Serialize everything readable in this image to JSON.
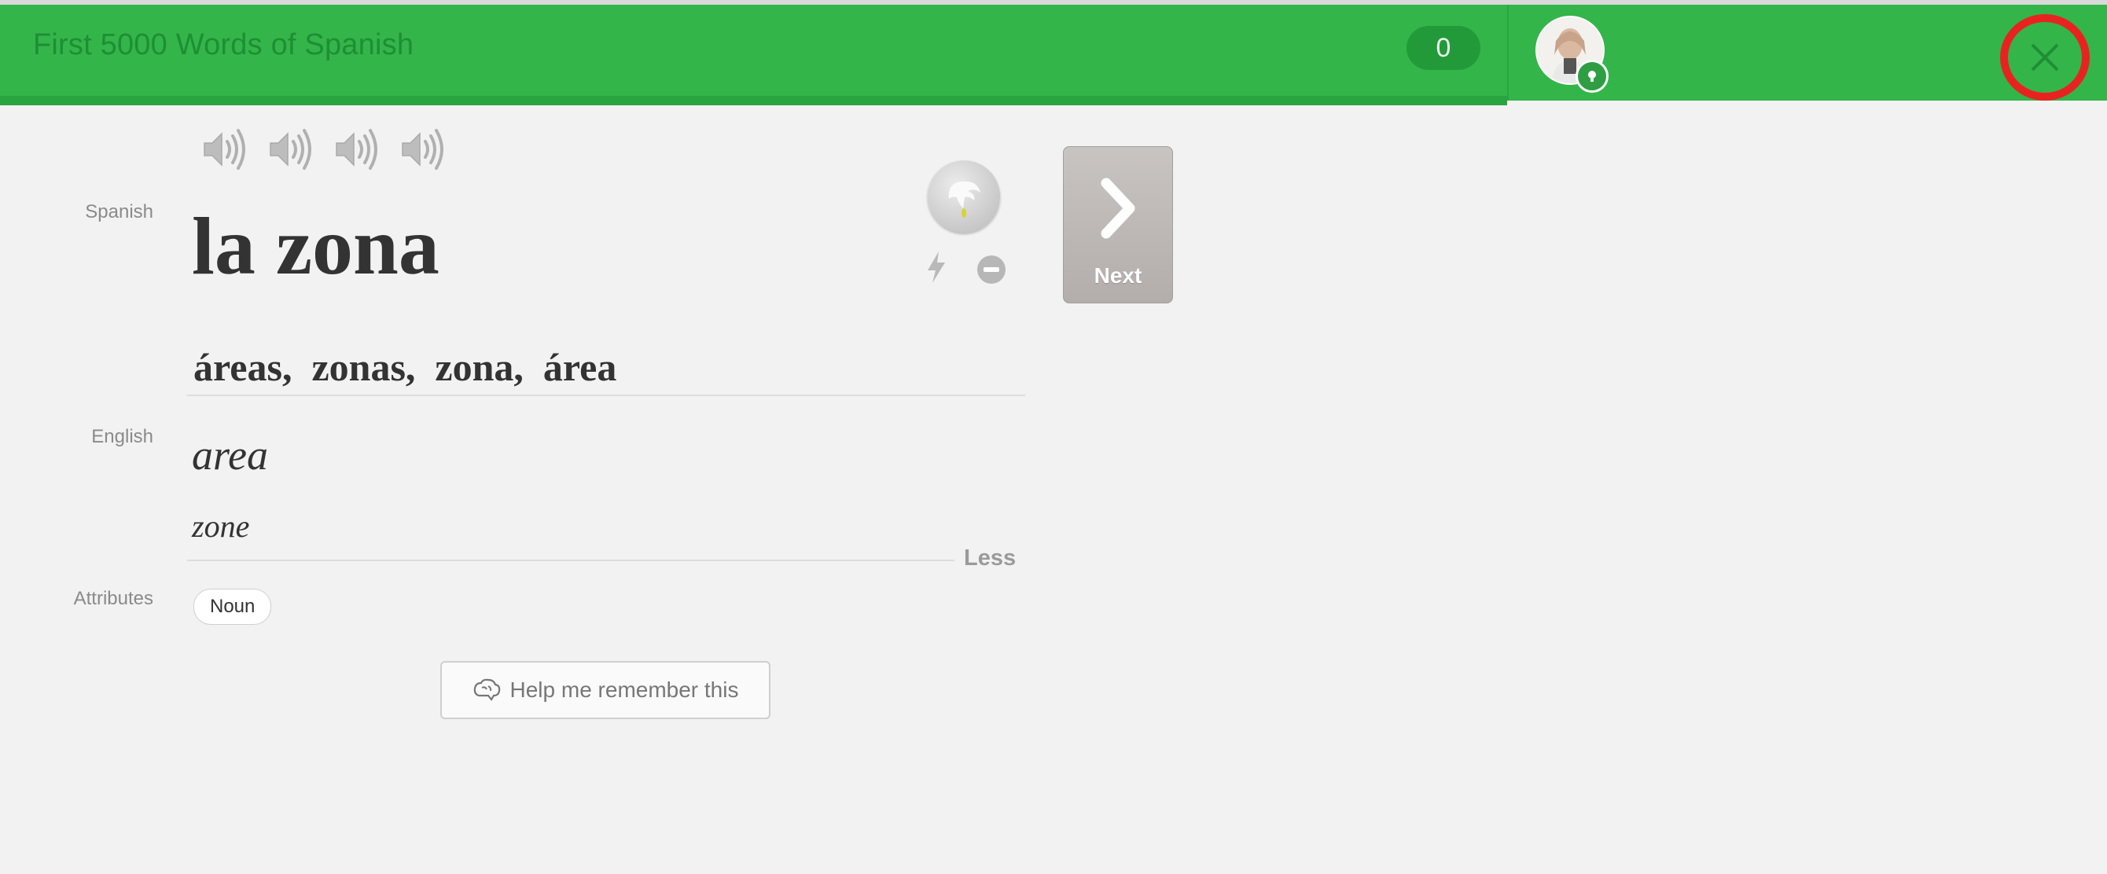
{
  "header": {
    "course_title": "First 5000 Words of Spanish",
    "points": "0",
    "close_icon": "close-icon",
    "accent_color": "#33b54a",
    "highlight_color": "#e8231f"
  },
  "labels": {
    "spanish": "Spanish",
    "english": "English",
    "attributes": "Attributes"
  },
  "audio": {
    "count": 4,
    "icon": "speaker-icon"
  },
  "word": {
    "main": "la zona",
    "alternatives": "áreas,  zonas,  zona,  área"
  },
  "english": {
    "primary": "area",
    "secondary": "zone",
    "less_link": "Less"
  },
  "attributes": [
    "Noun"
  ],
  "actions": {
    "next_label": "Next",
    "help_label": "Help me remember this"
  }
}
